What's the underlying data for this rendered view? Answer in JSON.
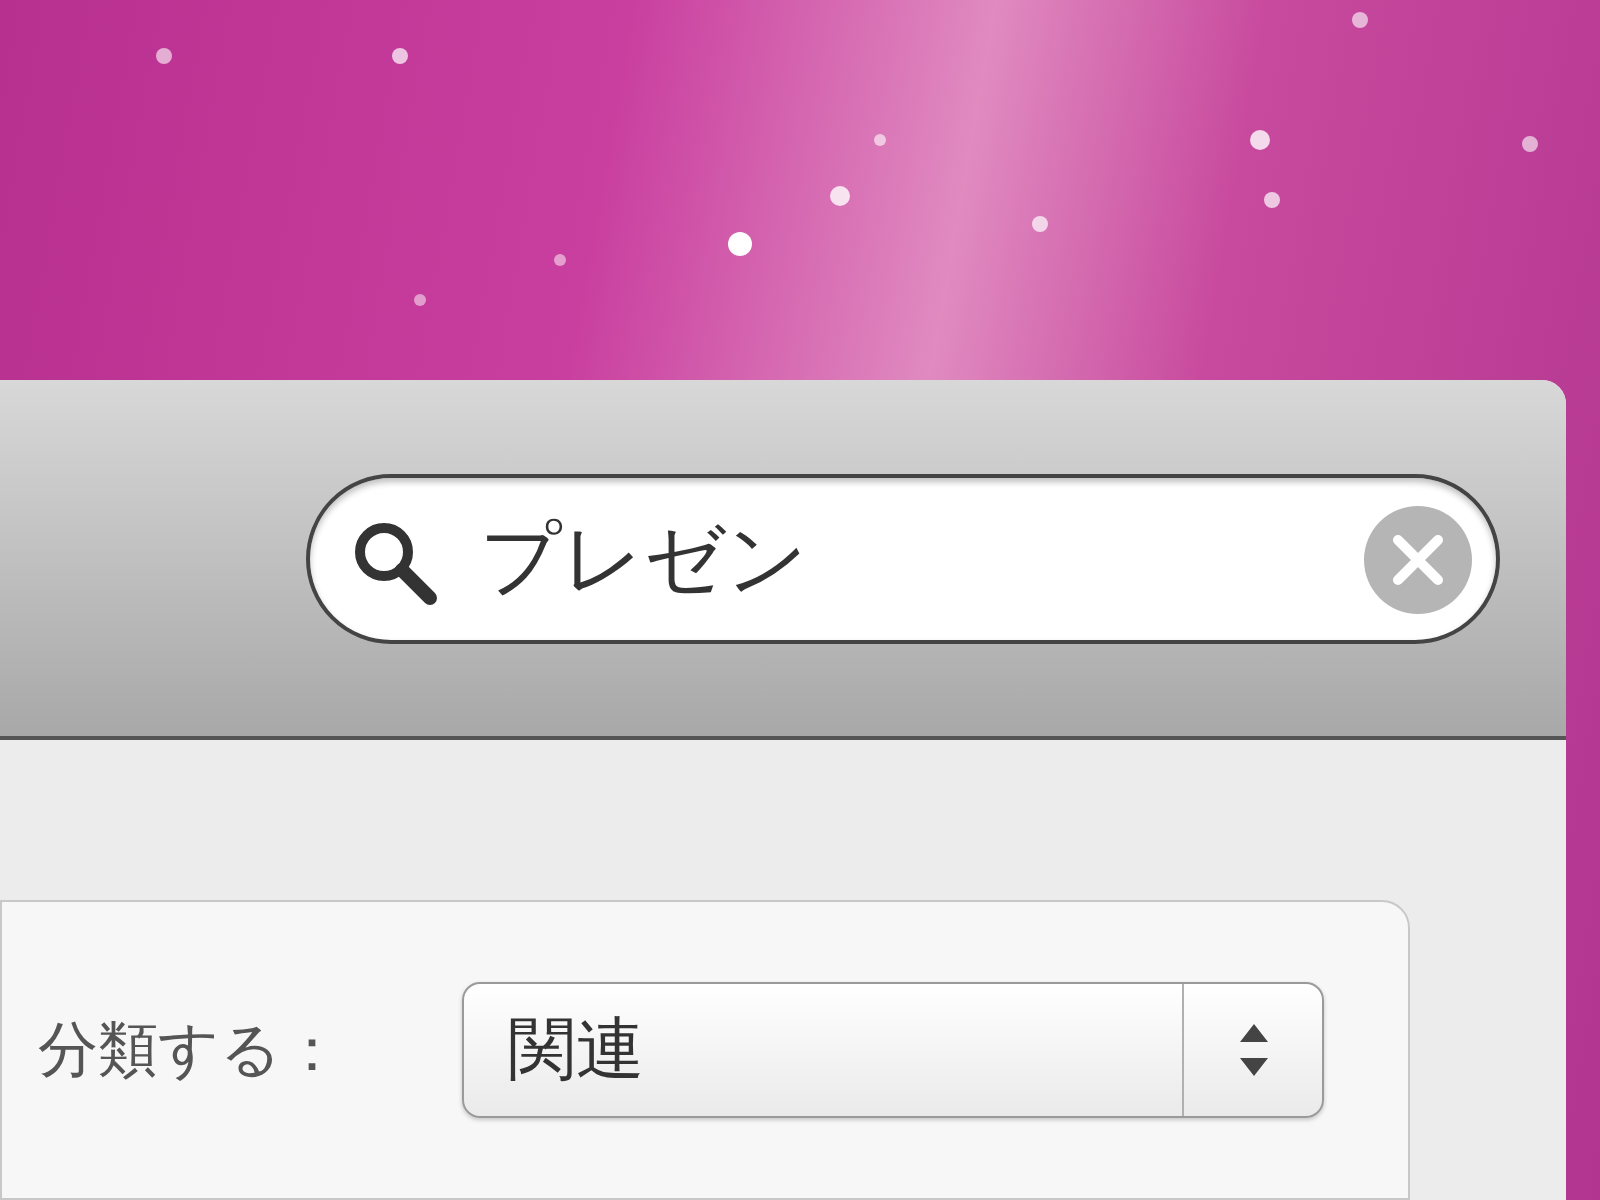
{
  "search": {
    "value": "プレゼン"
  },
  "sort": {
    "label": "分類する：",
    "value": "関連"
  }
}
